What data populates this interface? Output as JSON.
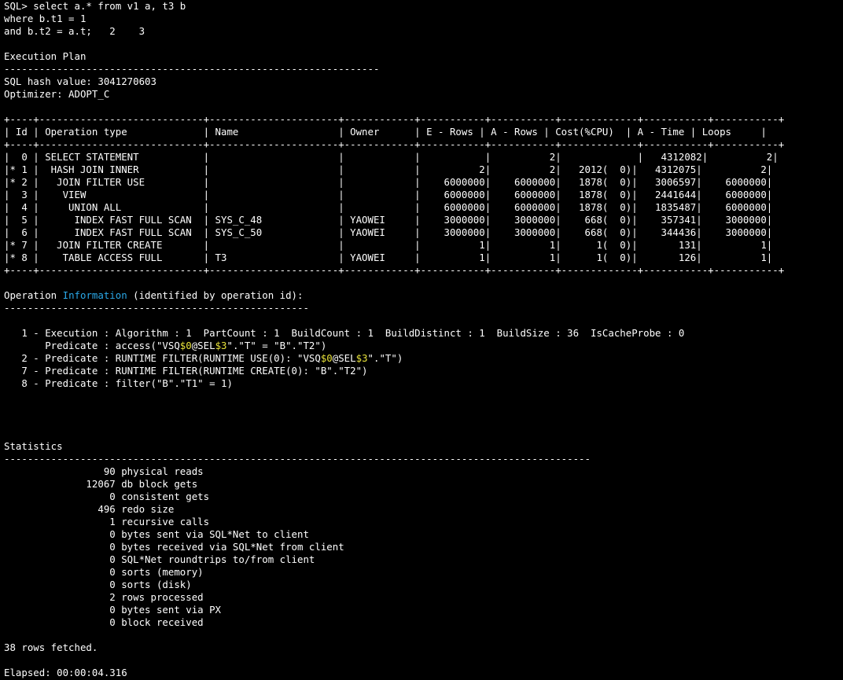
{
  "terminal": {
    "colors": {
      "background": "#000000",
      "text": "#ffffff",
      "highlight": "#e8e23a",
      "info": "#2aa8e8"
    },
    "lines": [
      [
        {
          "t": "SQL> select a.* from v1 a, t3 b"
        }
      ],
      [
        {
          "t": "where b.t1 = 1"
        }
      ],
      [
        {
          "t": "and b.t2 = a.t;   2    3"
        }
      ],
      [
        {
          "t": ""
        }
      ],
      [
        {
          "t": "Execution Plan"
        }
      ],
      [
        {
          "t": "----------------------------------------------------------------"
        }
      ],
      [
        {
          "t": "SQL hash value: 3041270603"
        }
      ],
      [
        {
          "t": "Optimizer: ADOPT_C"
        }
      ],
      [
        {
          "t": ""
        }
      ],
      [
        {
          "t": "+----+----------------------------+----------------------+------------+-----------+-----------+-------------+-----------+-----------+"
        }
      ],
      [
        {
          "t": "| Id | Operation type             | Name                 | Owner      | E - Rows | A - Rows | Cost(%CPU)  | A - Time | Loops     |"
        }
      ],
      [
        {
          "t": "+----+----------------------------+----------------------+------------+-----------+-----------+-------------+-----------+-----------+"
        }
      ],
      [
        {
          "t": "|  0 | SELECT STATEMENT           |                      |            |           |          2|             |   4312082|          2|"
        }
      ],
      [
        {
          "t": "|* 1 |  HASH JOIN INNER           |                      |            |          2|          2|   2012(  0)|   4312075|          2|"
        }
      ],
      [
        {
          "t": "|* 2 |   JOIN FILTER USE          |                      |            |    6000000|    6000000|   1878(  0)|   3006597|    6000000|"
        }
      ],
      [
        {
          "t": "|  3 |    VIEW                    |                      |            |    6000000|    6000000|   1878(  0)|   2441644|    6000000|"
        }
      ],
      [
        {
          "t": "|  4 |     UNION ALL              |                      |            |    6000000|    6000000|   1878(  0)|   1835487|    6000000|"
        }
      ],
      [
        {
          "t": "|  5 |      INDEX FAST FULL SCAN  | SYS_C_48             | YAOWEI     |    3000000|    3000000|    668(  0)|    357341|    3000000|"
        }
      ],
      [
        {
          "t": "|  6 |      INDEX FAST FULL SCAN  | SYS_C_50             | YAOWEI     |    3000000|    3000000|    668(  0)|    344436|    3000000|"
        }
      ],
      [
        {
          "t": "|* 7 |   JOIN FILTER CREATE       |                      |            |          1|          1|      1(  0)|       131|          1|"
        }
      ],
      [
        {
          "t": "|* 8 |    TABLE ACCESS FULL       | T3                   | YAOWEI     |          1|          1|      1(  0)|       126|          1|"
        }
      ],
      [
        {
          "t": "+----+----------------------------+----------------------+------------+-----------+-----------+-------------+-----------+-----------+"
        }
      ],
      [
        {
          "t": ""
        }
      ],
      [
        {
          "t": "Operation "
        },
        {
          "t": "Information",
          "c": "info"
        },
        {
          "t": " (identified by operation id):"
        }
      ],
      [
        {
          "t": "----------------------------------------------------"
        }
      ],
      [
        {
          "t": ""
        }
      ],
      [
        {
          "t": "   1 - Execution : Algorithm : 1  PartCount : 1  BuildCount : 1  BuildDistinct : 1  BuildSize : 36  IsCacheProbe : 0"
        }
      ],
      [
        {
          "t": "       Predicate : access(\"VSQ"
        },
        {
          "t": "$0",
          "c": "hl"
        },
        {
          "t": "@SEL"
        },
        {
          "t": "$3",
          "c": "hl"
        },
        {
          "t": "\".\"T\" = \"B\".\"T2\")"
        }
      ],
      [
        {
          "t": "   2 - Predicate : RUNTIME FILTER(RUNTIME USE(0): \"VSQ"
        },
        {
          "t": "$0",
          "c": "hl"
        },
        {
          "t": "@SEL"
        },
        {
          "t": "$3",
          "c": "hl"
        },
        {
          "t": "\".\"T\")"
        }
      ],
      [
        {
          "t": "   7 - Predicate : RUNTIME FILTER(RUNTIME CREATE(0): \"B\".\"T2\")"
        }
      ],
      [
        {
          "t": "   8 - Predicate : filter(\"B\".\"T1\" = 1)"
        }
      ],
      [
        {
          "t": ""
        }
      ],
      [
        {
          "t": ""
        }
      ],
      [
        {
          "t": ""
        }
      ],
      [
        {
          "t": ""
        }
      ],
      [
        {
          "t": "Statistics"
        }
      ],
      [
        {
          "t": "----------------------------------------------------------------------------------------------------"
        }
      ],
      [
        {
          "t": "                 90 physical reads"
        }
      ],
      [
        {
          "t": "              12067 db block gets"
        }
      ],
      [
        {
          "t": "                  0 consistent gets"
        }
      ],
      [
        {
          "t": "                496 redo size"
        }
      ],
      [
        {
          "t": "                  1 recursive calls"
        }
      ],
      [
        {
          "t": "                  0 bytes sent via SQL*Net to client"
        }
      ],
      [
        {
          "t": "                  0 bytes received via SQL*Net from client"
        }
      ],
      [
        {
          "t": "                  0 SQL*Net roundtrips to/from client"
        }
      ],
      [
        {
          "t": "                  0 sorts (memory)"
        }
      ],
      [
        {
          "t": "                  0 sorts (disk)"
        }
      ],
      [
        {
          "t": "                  2 rows processed"
        }
      ],
      [
        {
          "t": "                  0 bytes sent via PX"
        }
      ],
      [
        {
          "t": "                  0 block received"
        }
      ],
      [
        {
          "t": ""
        }
      ],
      [
        {
          "t": "38 rows fetched."
        }
      ],
      [
        {
          "t": ""
        }
      ],
      [
        {
          "t": "Elapsed: 00:00:04.316"
        }
      ]
    ]
  }
}
